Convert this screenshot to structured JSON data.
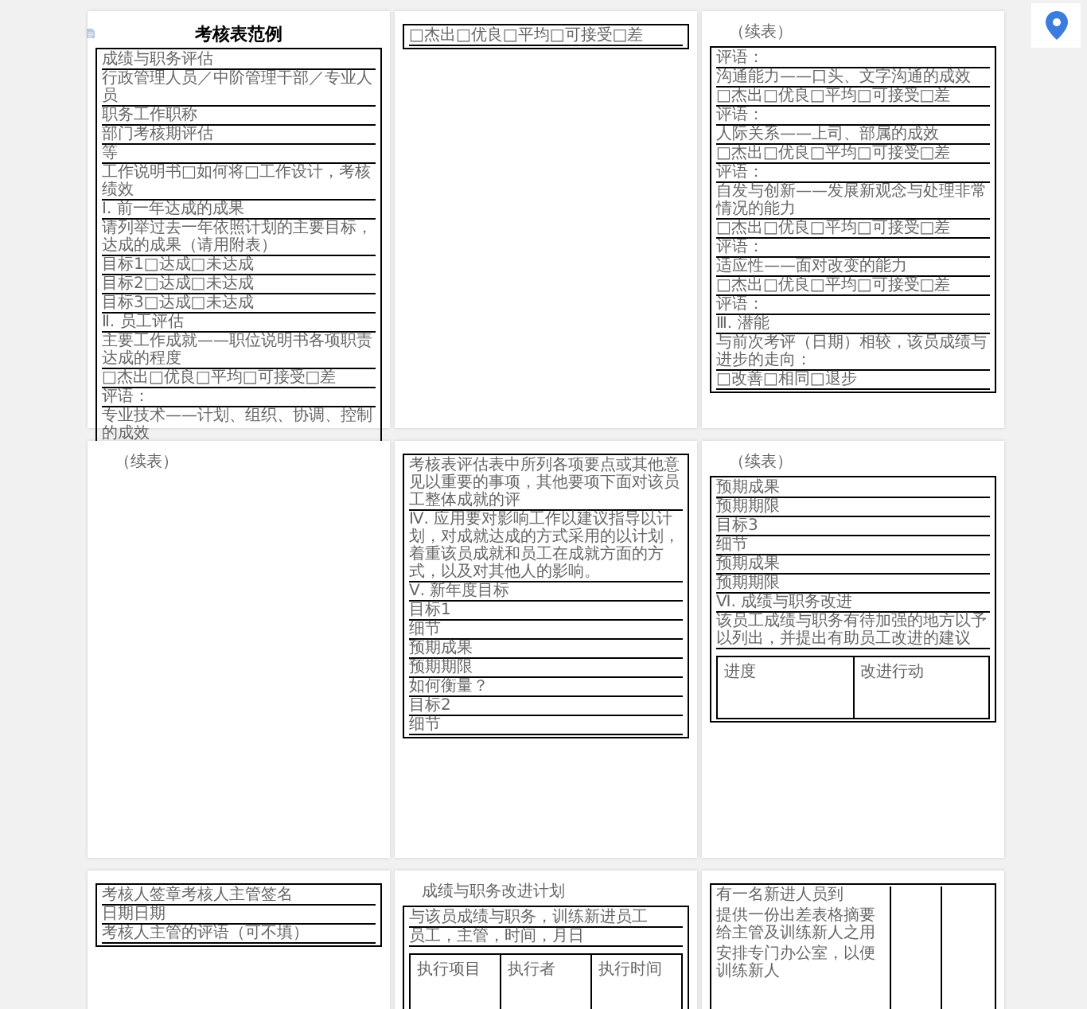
{
  "pages": [
    {
      "title": "考核表范例",
      "box": [
        {
          "kind": "text",
          "text": "成绩与职务评估"
        },
        {
          "kind": "text",
          "text": "行政管理人员／中阶管理干部／专业人员"
        },
        {
          "kind": "text",
          "text": "职务工作职称"
        },
        {
          "kind": "text",
          "text": "部门考核期评估"
        },
        {
          "kind": "text",
          "text": "等"
        },
        {
          "kind": "text",
          "text": "工作说明书□如何将□工作设计，考核绩效"
        },
        {
          "kind": "text",
          "text": "Ⅰ. 前一年达成的成果"
        },
        {
          "kind": "text",
          "text": "请列举过去一年依照计划的主要目标，达成的成果（请用附表）"
        },
        {
          "kind": "text",
          "text": "目标1□达成□未达成"
        },
        {
          "kind": "text",
          "text": "目标2□达成□未达成"
        },
        {
          "kind": "text",
          "text": "目标3□达成□未达成"
        },
        {
          "kind": "text",
          "text": "Ⅱ. 员工评估"
        },
        {
          "kind": "text",
          "text": "主要工作成就——职位说明书各项职责达成的程度"
        },
        {
          "kind": "text",
          "text": "□杰出□优良□平均□可接受□差"
        },
        {
          "kind": "text",
          "text": "评语："
        },
        {
          "kind": "text",
          "text": "专业技术——计划、组织、协调、控制的成效"
        }
      ]
    },
    {
      "box": [
        {
          "kind": "text",
          "text": "□杰出□优良□平均□可接受□差"
        }
      ]
    },
    {
      "above": [
        "（续表）"
      ],
      "box": [
        {
          "kind": "text",
          "text": "评语："
        },
        {
          "kind": "text",
          "text": "沟通能力——口头、文字沟通的成效"
        },
        {
          "kind": "text",
          "text": "□杰出□优良□平均□可接受□差"
        },
        {
          "kind": "text",
          "text": "评语："
        },
        {
          "kind": "text",
          "text": "人际关系——上司、部属的成效"
        },
        {
          "kind": "text",
          "text": "□杰出□优良□平均□可接受□差"
        },
        {
          "kind": "text",
          "text": "评语："
        },
        {
          "kind": "text",
          "text": "自发与创新——发展新观念与处理非常情况的能力"
        },
        {
          "kind": "text",
          "text": "□杰出□优良□平均□可接受□差"
        },
        {
          "kind": "text",
          "text": "评语："
        },
        {
          "kind": "text",
          "text": "适应性——面对改变的能力"
        },
        {
          "kind": "text",
          "text": "□杰出□优良□平均□可接受□差"
        },
        {
          "kind": "text",
          "text": "评语："
        },
        {
          "kind": "text",
          "text": "Ⅲ. 潜能"
        },
        {
          "kind": "text",
          "text": "与前次考评（日期）相较，该员成绩与进步的走向："
        },
        {
          "kind": "text",
          "text": "□改善□相同□退步"
        }
      ]
    },
    {
      "above": [
        "（续表）"
      ]
    },
    {
      "box": [
        {
          "kind": "text",
          "text": "考核表评估表中所列各项要点或其他意见以重要的事项，其他要项下面对该员工整体成就的评"
        },
        {
          "kind": "text",
          "text": "Ⅳ. 应用要对影响工作以建议指导以计划，对成就达成的方式采用的以计划，着重该员成就和员工在成就方面的方式，以及对其他人的影响。"
        },
        {
          "kind": "text",
          "text": "Ⅴ. 新年度目标"
        },
        {
          "kind": "text",
          "text": "目标1"
        },
        {
          "kind": "text",
          "text": "细节"
        },
        {
          "kind": "text",
          "text": "预期成果"
        },
        {
          "kind": "text",
          "text": "预期期限"
        },
        {
          "kind": "text",
          "text": "如何衡量？"
        },
        {
          "kind": "text",
          "text": "目标2"
        },
        {
          "kind": "text",
          "text": "细节"
        }
      ]
    },
    {
      "above": [
        "（续表）"
      ],
      "box": [
        {
          "kind": "text",
          "text": "预期成果"
        },
        {
          "kind": "text",
          "text": "预期期限"
        },
        {
          "kind": "text",
          "text": "目标3"
        },
        {
          "kind": "text",
          "text": "细节"
        },
        {
          "kind": "text",
          "text": "预期成果"
        },
        {
          "kind": "text",
          "text": "预期期限"
        },
        {
          "kind": "text",
          "text": "Ⅵ. 成绩与职务改进"
        },
        {
          "kind": "text",
          "text": "该员工成绩与职务有待加强的地方以予以列出，并提出有助员工改进的建议"
        },
        {
          "kind": "table",
          "columns": [
            "进度",
            "改进行动"
          ]
        }
      ]
    },
    {
      "box": [
        {
          "kind": "text",
          "text": "考核人签章考核人主管签名"
        },
        {
          "kind": "text",
          "text": "日期日期"
        },
        {
          "kind": "text",
          "text": "考核人主管的评语（可不填）"
        }
      ]
    },
    {
      "above": [
        "成绩与职务改进计划"
      ],
      "box": [
        {
          "kind": "text",
          "text": "与该员成绩与职务，训练新进员工"
        },
        {
          "kind": "text",
          "text": "员工，主管，时间，月日"
        },
        {
          "kind": "table",
          "columns": [
            "执行项目",
            "执行者",
            "执行时间"
          ]
        }
      ]
    },
    {
      "box": [
        {
          "kind": "side_table",
          "cells": [
            "有一名新进人员到",
            "提供一份出差表格摘要给主管及训练新人之用",
            "安排专门办公室，以便训练新人"
          ]
        }
      ]
    }
  ]
}
